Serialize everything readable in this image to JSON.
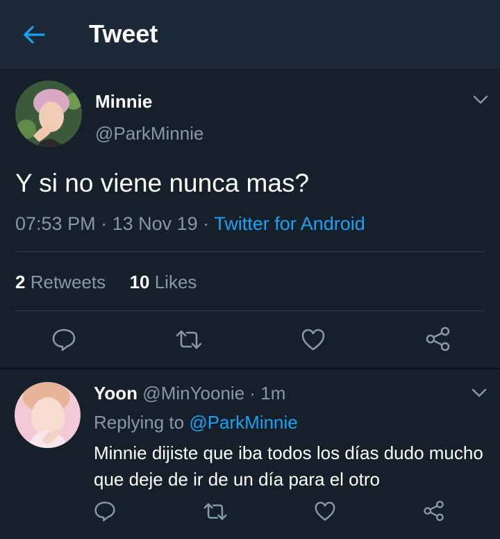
{
  "header": {
    "title": "Tweet",
    "back_icon": "arrow-left-icon"
  },
  "tweet": {
    "name": "Minnie",
    "handle": "@ParkMinnie",
    "text": "Y si no viene nunca mas?",
    "time": "07:53 PM",
    "date": "13 Nov 19",
    "source": "Twitter for Android",
    "retweets": "2",
    "retweets_label": "Retweets",
    "likes": "10",
    "likes_label": "Likes"
  },
  "reply": {
    "name": "Yoon",
    "handle": "@MinYoonie",
    "age": "1m",
    "replying_label": "Replying to",
    "mention": "@ParkMinnie",
    "text": "Minnie dijiste que iba todos los días dudo mucho que deje de ir de un día para el otro"
  },
  "colors": {
    "background": "#15202b",
    "header": "#1c2938",
    "accent": "#1da1f2",
    "muted": "#8899a6"
  }
}
